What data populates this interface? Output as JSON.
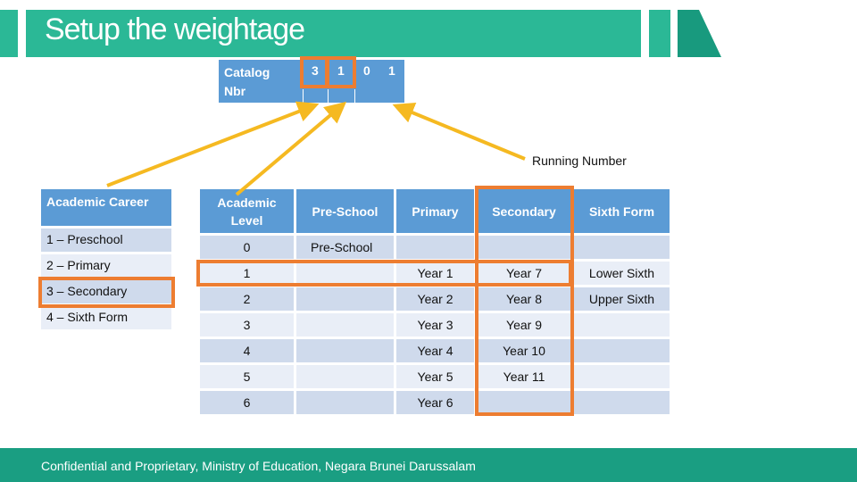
{
  "header": {
    "title": "Setup the weightage",
    "accent_color": "#2bb896"
  },
  "catalog": {
    "label_line1": "Catalog",
    "label_line2": "Nbr",
    "digits": [
      "3",
      "1",
      "0",
      "1"
    ],
    "annotation": "Running Number"
  },
  "career_table": {
    "header": "Academic Career",
    "rows": [
      "1 – Preschool",
      "2 – Primary",
      "3 – Secondary",
      "4 – Sixth Form"
    ],
    "highlighted_index": 2
  },
  "level_table": {
    "headers": [
      "Academic Level",
      "Pre-School",
      "Primary",
      "Secondary",
      "Sixth Form"
    ],
    "rows": [
      [
        "0",
        "Pre-School",
        "",
        "",
        ""
      ],
      [
        "1",
        "",
        "Year 1",
        "Year 7",
        "Lower Sixth"
      ],
      [
        "2",
        "",
        "Year 2",
        "Year 8",
        "Upper Sixth"
      ],
      [
        "3",
        "",
        "Year 3",
        "Year 9",
        ""
      ],
      [
        "4",
        "",
        "Year 4",
        "Year 10",
        ""
      ],
      [
        "5",
        "",
        "Year 5",
        "Year 11",
        ""
      ],
      [
        "6",
        "",
        "Year 6",
        "",
        ""
      ]
    ],
    "highlighted_row": 1,
    "highlighted_column": "Secondary"
  },
  "footer": {
    "text": "Confidential and Proprietary, Ministry of Education, Negara Brunei Darussalam"
  },
  "colors": {
    "highlight": "#ed7d31",
    "arrow": "#f5b921",
    "table_header": "#5b9bd5",
    "footer": "#1a9e82"
  }
}
